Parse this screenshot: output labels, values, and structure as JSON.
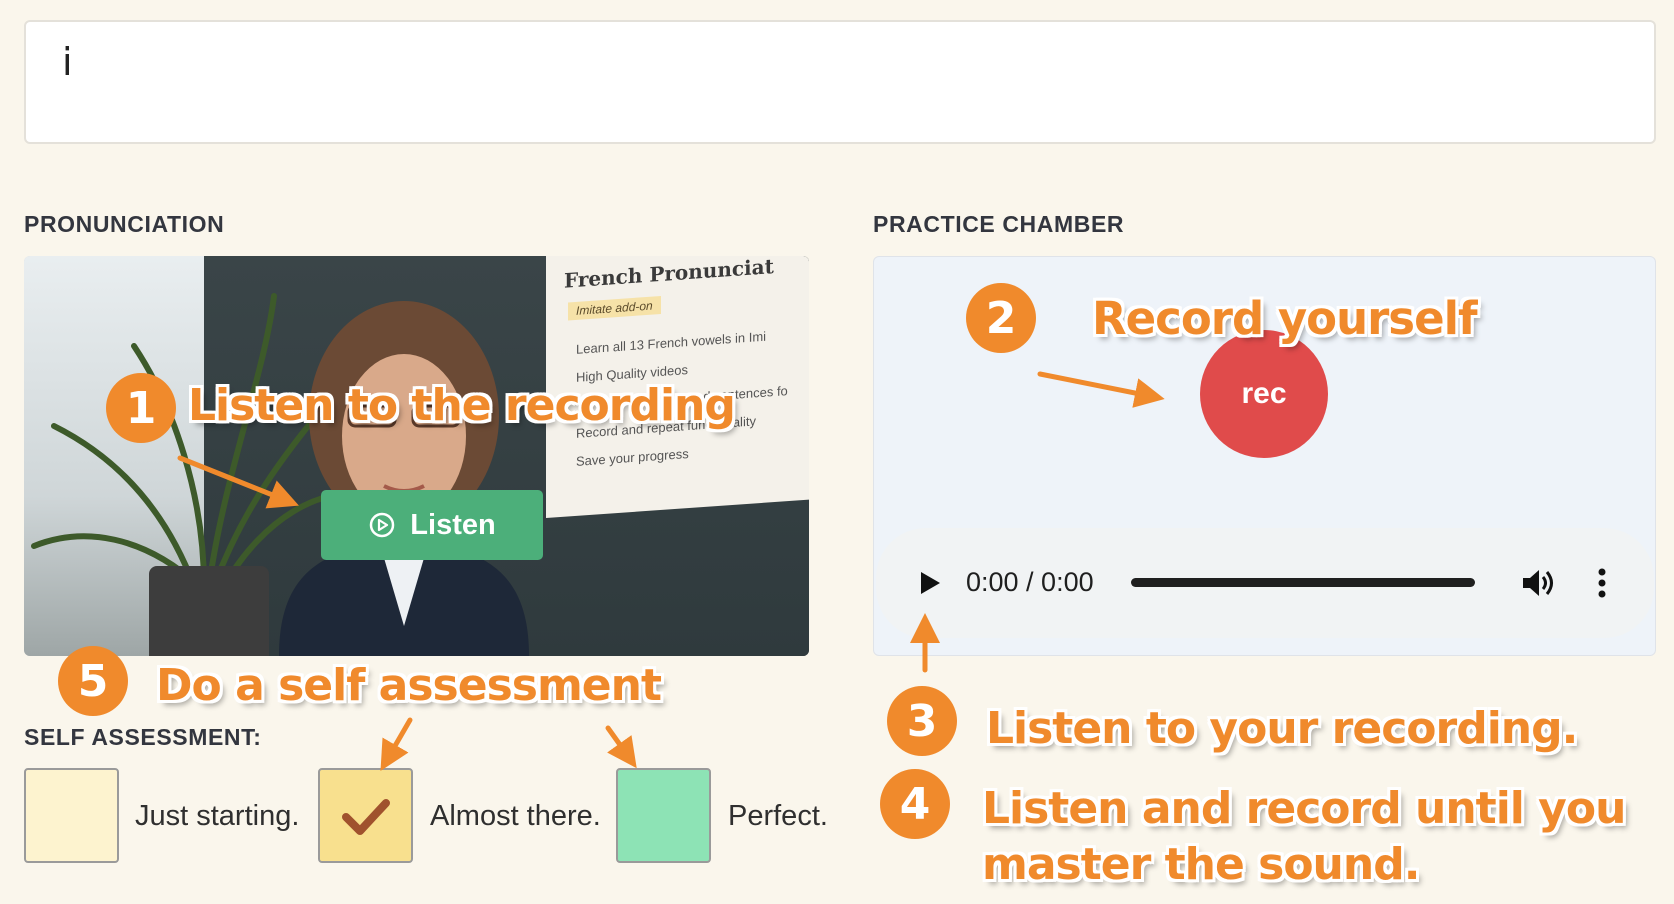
{
  "word": {
    "text": "i"
  },
  "sections": {
    "pronunciation": "PRONUNCIATION",
    "practice": "PRACTICE CHAMBER",
    "self_assessment": "SELF ASSESSMENT:"
  },
  "video": {
    "poster_title": "French Pronunciat",
    "poster_tag": "Imitate add-on",
    "poster_lines": [
      "Learn all 13 French vowels in Imi",
      "High Quality videos",
      "nd sentences fo",
      "Record and repeat functionality",
      "Save your progress"
    ],
    "listen_label": "Listen",
    "listen_icon": "play-circle-icon"
  },
  "practice": {
    "rec_label": "rec",
    "time": "0:00 / 0:00"
  },
  "assessment": {
    "options": [
      {
        "label": "Just starting.",
        "color": "#fdf3cf",
        "checked": false
      },
      {
        "label": "Almost there.",
        "color": "#f8e08e",
        "checked": true
      },
      {
        "label": "Perfect.",
        "color": "#8de3b5",
        "checked": false
      }
    ]
  },
  "annotations": {
    "step1": {
      "num": "1",
      "text": "Listen to the recording"
    },
    "step2": {
      "num": "2",
      "text": "Record yourself"
    },
    "step3": {
      "num": "3",
      "text": "Listen to your recording."
    },
    "step4": {
      "num": "4",
      "text": "Listen and record until you",
      "text2": "master the sound."
    },
    "step5": {
      "num": "5",
      "text": "Do a self assessment"
    }
  },
  "colors": {
    "accent": "#f08a2c",
    "listen_button": "#4caf7a",
    "rec_button": "#e04b4b",
    "checkmark": "#a0522d"
  }
}
